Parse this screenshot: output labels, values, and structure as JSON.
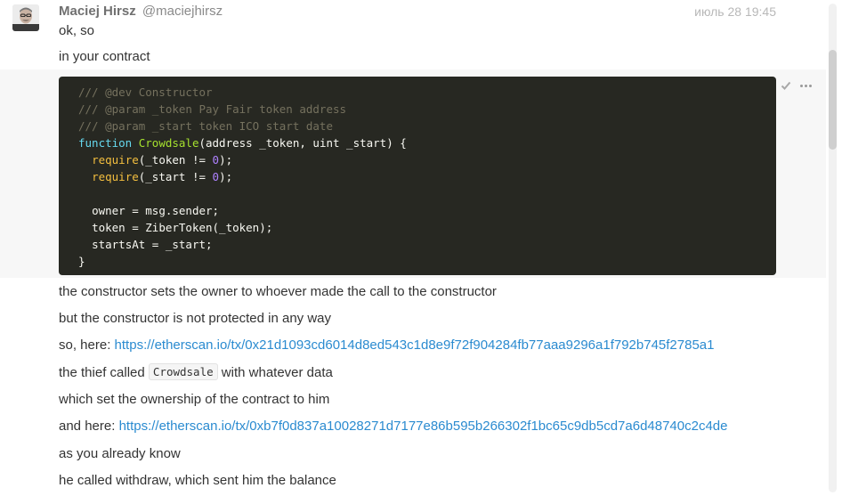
{
  "message": {
    "author_name": "Maciej Hirsz",
    "author_handle": "@maciejhirsz",
    "timestamp": "июль 28 19:45",
    "avatar_icon": "user-avatar-photo"
  },
  "lines": {
    "l1": "ok, so",
    "l2": "in your contract",
    "l3": "the constructor sets the owner to whoever made the call to the constructor",
    "l4": "but the constructor is not protected in any way",
    "l5_prefix": "so, here: ",
    "l5_link": "https://etherscan.io/tx/0x21d1093cd6014d8ed543c1d8e9f72f904284fb77aaa9296a1f792b745f2785a1",
    "l6_prefix": "the thief called ",
    "l6_code": "Crowdsale",
    "l6_suffix": " with whatever data",
    "l7": "which set the ownership of the contract to him",
    "l8_prefix": "and here: ",
    "l8_link": "https://etherscan.io/tx/0xb7f0d837a10028271d7177e86b595b266302f1bc65c9db5cd7a6d48740c2c4de",
    "l9": "as you already know",
    "l10": "he called withdraw, which sent him the balance"
  },
  "code": {
    "c1": "/// @dev Constructor",
    "c2": "/// @param _token Pay Fair token address",
    "c3": "/// @param _start token ICO start date",
    "c4_kw": "function",
    "c4_name": "Crowdsale",
    "c4_rest": "(address _token, uint _start) {",
    "c5_req": "require",
    "c5_a": "(_token != ",
    "c5_num": "0",
    "c5_b": ");",
    "c6_req": "require",
    "c6_a": "(_start != ",
    "c6_num": "0",
    "c6_b": ");",
    "c8": "owner = msg.sender;",
    "c9": "token = ZiberToken(_token);",
    "c10": "startsAt = _start;",
    "c11": "}"
  },
  "icons": {
    "check": "check-icon",
    "more": "more-icon"
  },
  "colors": {
    "link": "#2b8bd0",
    "code_bg": "#272822",
    "hover_bg": "#f7f7f7"
  }
}
